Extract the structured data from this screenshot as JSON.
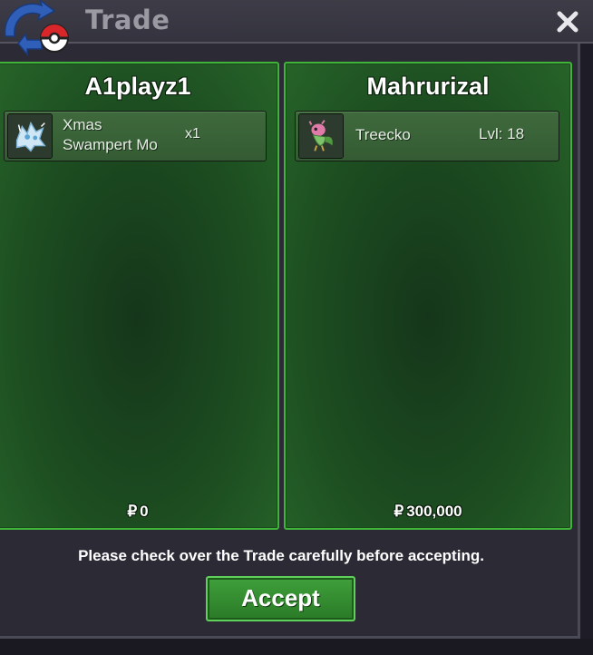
{
  "window": {
    "title": "Trade",
    "close_glyph": "✕",
    "trade_icon": "trade-arrows-pokeball-icon"
  },
  "left": {
    "name": "A1playz1",
    "item": {
      "name_line1": "Xmas",
      "name_line2": "Swampert Mo",
      "quantity": "x1",
      "icon": "swampert-sprite-icon"
    },
    "money": {
      "currency_symbol": "₽",
      "amount": "0"
    }
  },
  "right": {
    "name": "Mahrurizal",
    "item": {
      "name": "Treecko",
      "level": "Lvl: 18",
      "icon": "treecko-sprite-icon"
    },
    "money": {
      "currency_symbol": "₽",
      "amount": "300,000"
    }
  },
  "notice": "Please check over the Trade carefully before accepting.",
  "accept_label": "Accept",
  "colors": {
    "panel_border": "#3fb33a",
    "accent_green": "#3fa03a",
    "window_bg": "#2b2a35"
  }
}
